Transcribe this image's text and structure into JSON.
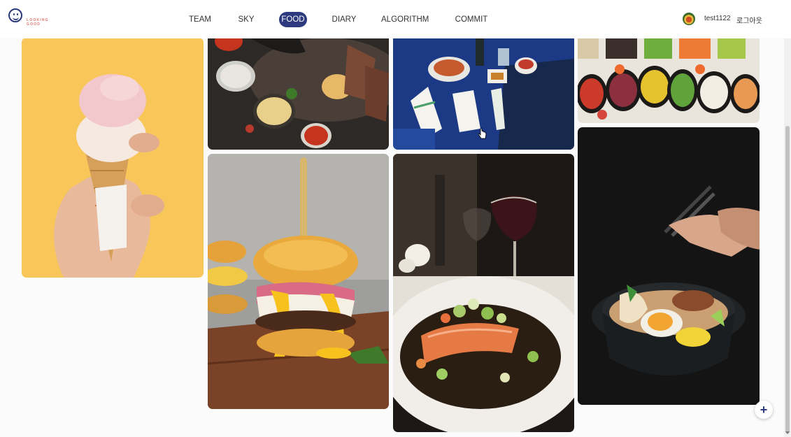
{
  "logo": {
    "text_line1": "LOOKING",
    "text_line2": "GOOD"
  },
  "nav": {
    "items": [
      {
        "label": "TEAM",
        "active": false
      },
      {
        "label": "SKY",
        "active": false
      },
      {
        "label": "FOOD",
        "active": true
      },
      {
        "label": "DIARY",
        "active": false
      },
      {
        "label": "ALGORITHM",
        "active": false
      },
      {
        "label": "COMMIT",
        "active": false
      }
    ]
  },
  "user": {
    "name": "test1122",
    "logout_label": "로그아웃",
    "avatar_icon": "food-avatar-icon"
  },
  "gallery": {
    "photos": [
      {
        "subject": "ice-cream-cone",
        "accent": "#f7c04a"
      },
      {
        "subject": "grilled-meat-platter-with-sauces",
        "accent": "#3a3330"
      },
      {
        "subject": "korean-table-setting",
        "accent": "#1d3f8a"
      },
      {
        "subject": "salad-bar-bowls",
        "accent": "#e8e2d8"
      },
      {
        "subject": "eggs-benedict-burger",
        "accent": "#a9a9a9"
      },
      {
        "subject": "salmon-dinner-with-wine",
        "accent": "#1b1715"
      },
      {
        "subject": "ramen-bowl-with-chopsticks",
        "accent": "#141414"
      }
    ]
  },
  "fab": {
    "label": "+",
    "icon": "plus-icon"
  },
  "colors": {
    "accent": "#2e3a80",
    "background": "#fbfbfb"
  }
}
